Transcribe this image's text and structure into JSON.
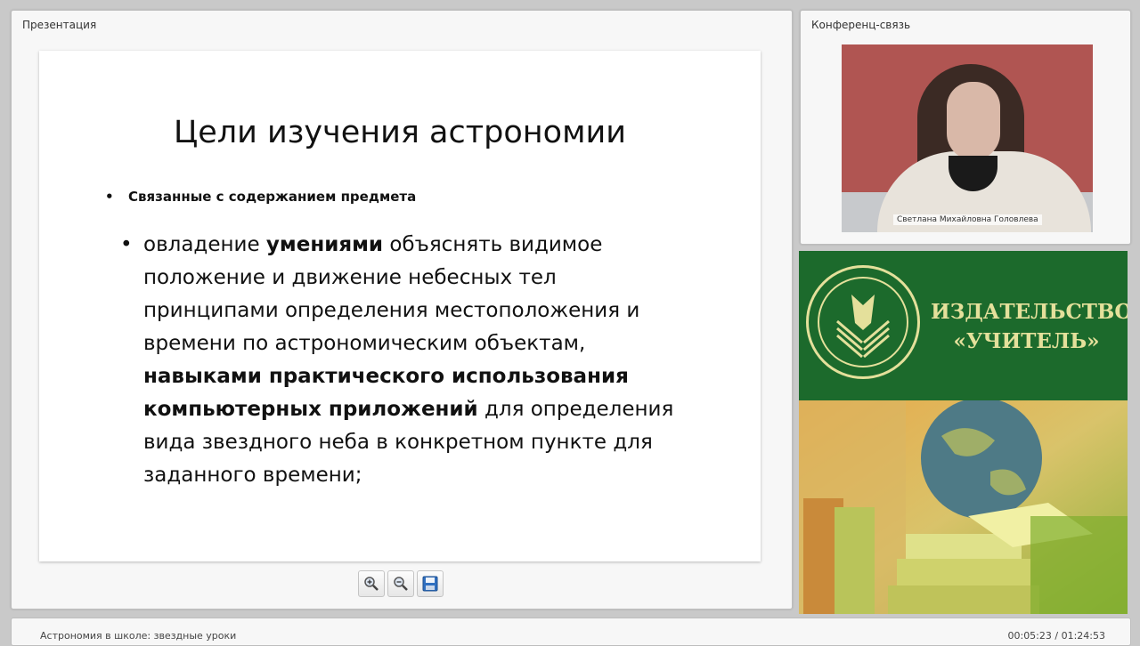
{
  "presentation": {
    "panel_title": "Презентация",
    "slide": {
      "title": "Цели изучения астрономии",
      "sub_bullet": "Связанные с содержанием предмета",
      "main_bullet": {
        "p1": "овладение ",
        "b1": "умениями",
        "p2": " объяснять видимое положение и движение небесных тел принципами определения местоположения и времени по астрономическим объектам, ",
        "b2": "навыками практического использования компьютерных приложений",
        "p3": " для определения вида звездного неба в конкретном пункте для заданного времени;"
      }
    },
    "toolbar": {
      "zoom_in_icon": "zoom-in-icon",
      "zoom_out_icon": "zoom-out-icon",
      "save_icon": "save-icon"
    }
  },
  "conference": {
    "panel_title": "Конференц-связь",
    "participant_name": "Светлана Михайловна Головлева"
  },
  "ad": {
    "line1": "ИЗДАТЕЛЬСТВО",
    "line2": "«УЧИТЕЛЬ»",
    "colors": {
      "green": "#1c6a2c",
      "cream": "#e4e09b"
    }
  },
  "footer": {
    "course_title": "Астрономия в школе: звездные уроки",
    "time": "00:05:23 / 01:24:53"
  }
}
